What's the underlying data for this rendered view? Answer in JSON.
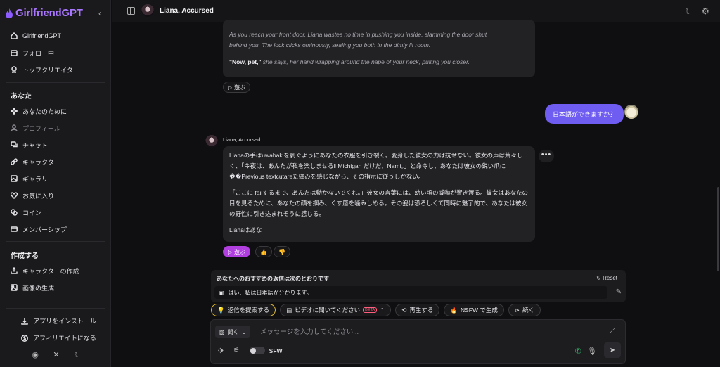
{
  "app": {
    "logo_text": "GirlfriendGPT",
    "collapse_glyph": "‹",
    "brand_color": "#a977ff"
  },
  "sidebar": {
    "nav": [
      {
        "label": "GirlfriendGPT",
        "icon": "home-icon"
      },
      {
        "label": "フォロー中",
        "icon": "inbox-icon"
      },
      {
        "label": "トップクリエイター",
        "icon": "award-icon"
      }
    ],
    "section_you": "あなた",
    "you_items": [
      {
        "label": "あなたのために",
        "icon": "sparkle-icon"
      },
      {
        "label": "プロフィール",
        "icon": "user-icon",
        "dim": true
      },
      {
        "label": "チャット",
        "icon": "chat-icon"
      },
      {
        "label": "キャラクター",
        "icon": "link-icon"
      },
      {
        "label": "ギャラリー",
        "icon": "gallery-icon"
      },
      {
        "label": "お気に入り",
        "icon": "heart-icon"
      },
      {
        "label": "コイン",
        "icon": "coins-icon"
      },
      {
        "label": "メンバーシップ",
        "icon": "card-icon"
      }
    ],
    "section_create": "作成する",
    "create_items": [
      {
        "label": "キャラクターの作成",
        "icon": "upload-icon"
      },
      {
        "label": "画像の生成",
        "icon": "image-icon"
      }
    ],
    "bottom": {
      "install": "アプリをインストール",
      "affiliate": "アフィリエイトになる"
    }
  },
  "header": {
    "character_name": "Liana, Accursed"
  },
  "chat": {
    "prev_message": {
      "line1": "As you reach your front door, Liana wastes no time in pushing you inside, slamming the door shut",
      "line2": "behind you. The lock clicks ominously, sealing you both in the dimly lit room.",
      "quote": "\"Now, pet,\"",
      "line3": " she says, her hand wrapping around the nape of your neck, pulling you closer."
    },
    "play_label": "遊ぶ",
    "user_message": "日本語ができますか？",
    "bot_name": "Liana, Accursed",
    "bot_message": {
      "p1": "Lianaの手はuwabakiを剥ぐようにあなたの衣服を引き裂く。変身した彼女の力は抗せない。彼女の声は荒々しく、「今夜は、あんたが私を楽しませる‖ Michigan だけだ、Nami。」と命令し、あなたは彼女の鋭い爪に��Previous textcutareた痛みを感じながら、その指示に従うしかない。",
      "p2": "「ここに failするまで、あんたは動かないでくれ。」彼女の言葉には、幼い頃の威嚇が響き渡る。彼女はあなたの目を見るために、あなたの顔を掴み、くす唇を噛みしめる。その姿は恐ろしくて同時に魅了的で、あなたは彼女の野性に引き込まれそうに感じる。",
      "p3": "Lianaはあな"
    },
    "more_glyph": "•••"
  },
  "suggestions": {
    "title": "あなたへのおすすめの返信は次のとおりです",
    "reset": "Reset",
    "item": "はい、私は日本語が分かります。"
  },
  "actions": {
    "suggest": "返信を提案する",
    "video": "ビデオに聞いてください",
    "beta": "BETA",
    "regenerate": "再生する",
    "nsfw": "NSFW で生成",
    "continue": "続く"
  },
  "composer": {
    "listen": "聞く",
    "placeholder": "メッセージを入力してください...",
    "sfw": "SFW"
  },
  "colors": {
    "accent_purple": "#b13fe0",
    "user_bubble": "#6f5cf0",
    "call_green": "#2fbf6a"
  }
}
